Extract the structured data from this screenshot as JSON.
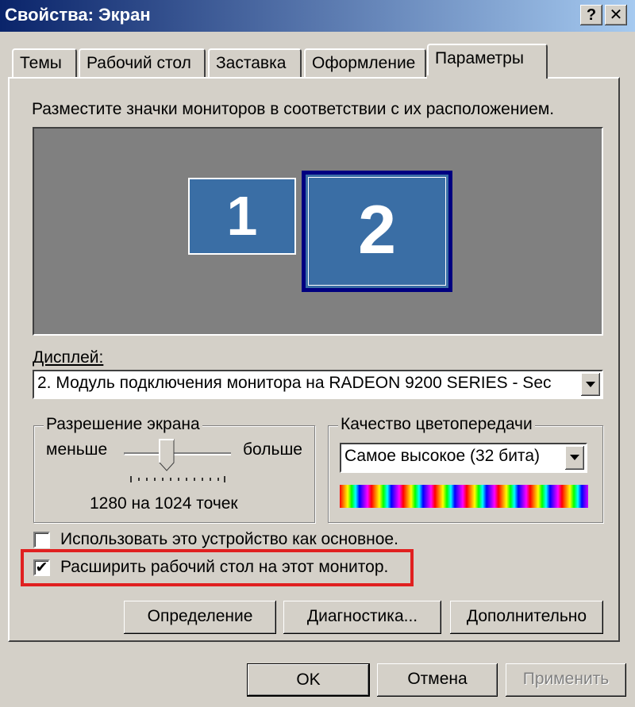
{
  "window": {
    "title": "Свойства: Экран",
    "help_glyph": "?",
    "close_glyph": "✕"
  },
  "tabs": [
    {
      "label": "Темы"
    },
    {
      "label": "Рабочий стол"
    },
    {
      "label": "Заставка"
    },
    {
      "label": "Оформление"
    },
    {
      "label": "Параметры",
      "active": true
    }
  ],
  "settings": {
    "instruction": "Разместите значки мониторов в соответствии с их расположением.",
    "monitors": [
      {
        "number": "1",
        "selected": false
      },
      {
        "number": "2",
        "selected": true
      }
    ],
    "display_label": "Дисплей:",
    "display_value": "2. Модуль подключения монитора на RADEON 9200 SERIES - Sec",
    "resolution": {
      "legend": "Разрешение экрана",
      "less_label": "меньше",
      "more_label": "больше",
      "value_text": "1280 на 1024 точек"
    },
    "color_quality": {
      "legend": "Качество цветопередачи",
      "value": "Самое высокое (32 бита)"
    },
    "primary_checkbox": {
      "label": "Использовать это устройство как основное.",
      "checked": false
    },
    "extend_checkbox": {
      "label": "Расширить рабочий стол на этот монитор.",
      "checked": true,
      "check_glyph": "✔"
    },
    "buttons": {
      "identify": "Определение",
      "troubleshoot": "Диагностика...",
      "advanced": "Дополнительно"
    }
  },
  "footer": {
    "ok": "OK",
    "cancel": "Отмена",
    "apply": "Применить"
  },
  "colors": {
    "titlebar_start": "#0a246a",
    "monitor_blue": "#3a6ea5",
    "highlight_red": "#e02020"
  }
}
